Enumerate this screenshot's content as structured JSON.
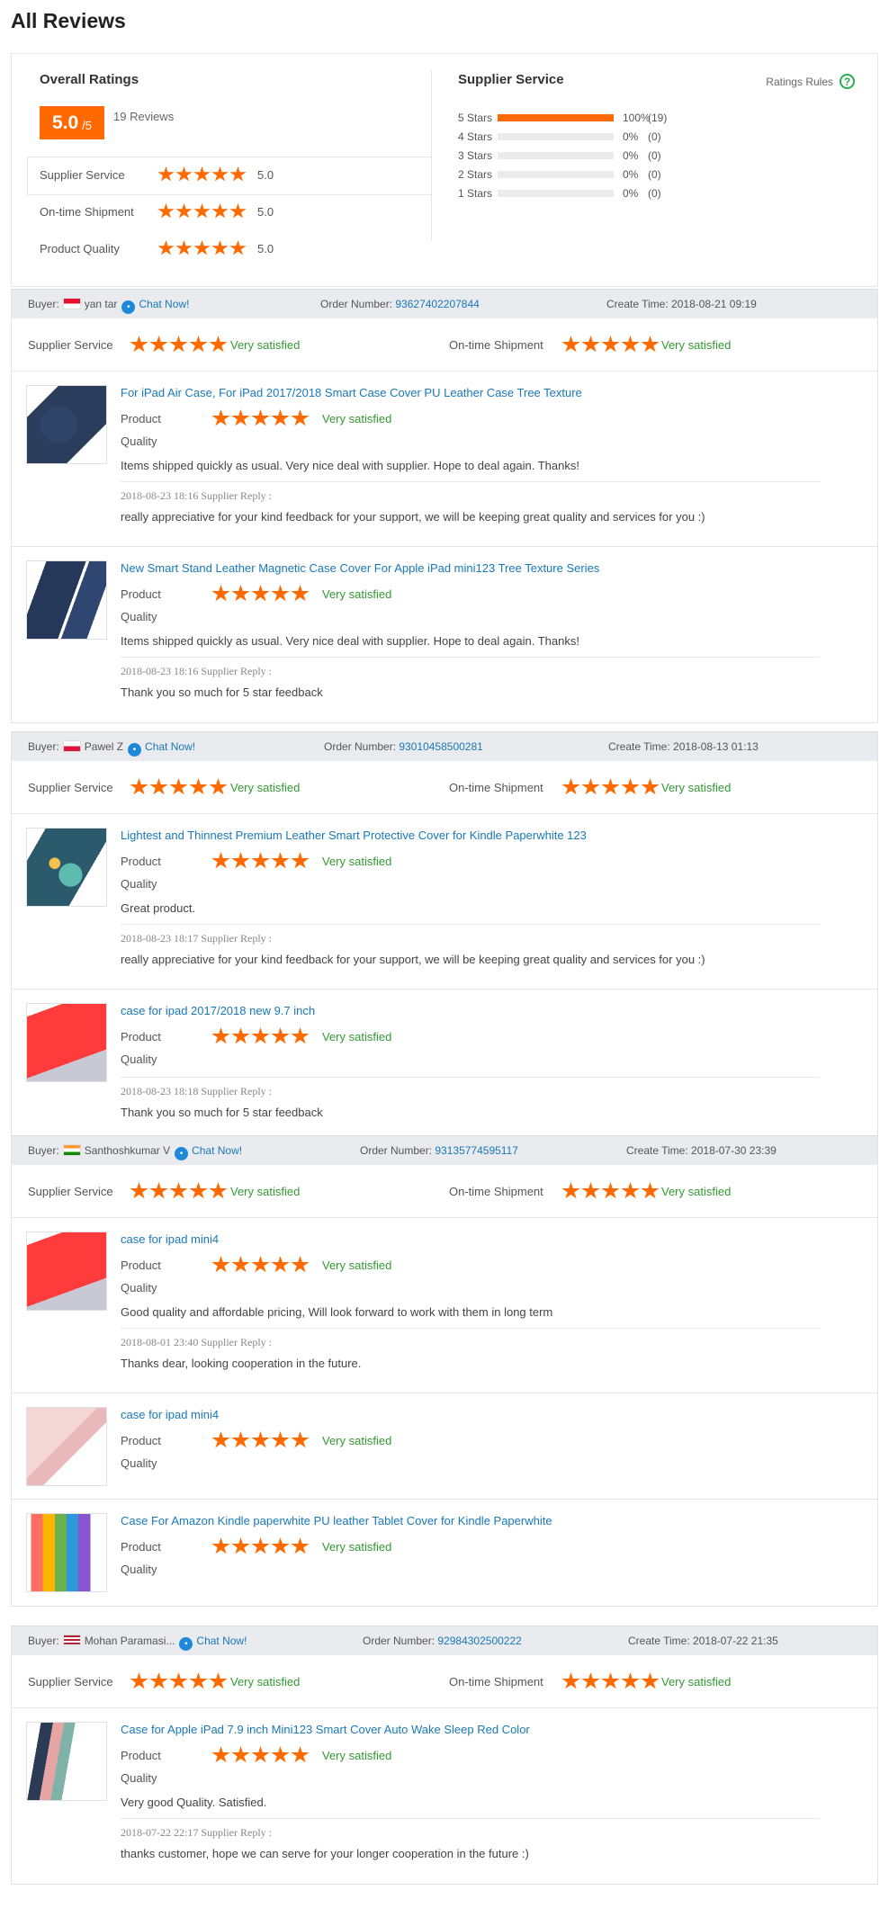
{
  "page_title": "All Reviews",
  "summary": {
    "overall_label": "Overall Ratings",
    "score": "5.0",
    "score_max": "/5",
    "reviews_count": "19 Reviews",
    "rows": [
      {
        "label": "Supplier Service",
        "value": "5.0",
        "stars": 5
      },
      {
        "label": "On-time Shipment",
        "value": "5.0",
        "stars": 5
      },
      {
        "label": "Product Quality",
        "value": "5.0",
        "stars": 5
      }
    ],
    "supplier_service_title": "Supplier Service",
    "ratings_rules": "Ratings Rules",
    "distribution": [
      {
        "label": "5 Stars",
        "percent": "100%",
        "count": "(19)",
        "fill": 1.0
      },
      {
        "label": "4 Stars",
        "percent": "0%",
        "count": "(0)",
        "fill": 0
      },
      {
        "label": "3 Stars",
        "percent": "0%",
        "count": "(0)",
        "fill": 0
      },
      {
        "label": "2 Stars",
        "percent": "0%",
        "count": "(0)",
        "fill": 0
      },
      {
        "label": "1 Stars",
        "percent": "0%",
        "count": "(0)",
        "fill": 0
      }
    ]
  },
  "labels": {
    "buyer": "Buyer:",
    "chat_now": "Chat Now!",
    "order_number": "Order Number:",
    "create_time": "Create Time:",
    "supplier_service": "Supplier Service",
    "on_time_shipment": "On-time Shipment",
    "very_satisfied": "Very satisfied",
    "product": "Product",
    "quality": "Quality",
    "supplier_reply": "Supplier Reply :"
  },
  "orders": [
    {
      "buyer": "yan tar",
      "flag": "sg",
      "order_number": "93627402207844",
      "create_time": "2018-08-21 09:19",
      "items": [
        {
          "title": "For iPad Air Case, For iPad 2017/2018 Smart Case Cover PU Leather Case Tree Texture",
          "thumb": "navy-case",
          "feedback": "Items shipped quickly as usual. Very nice deal with supplier. Hope to deal again. Thanks!",
          "reply_time": "2018-08-23 18:16",
          "reply": "really appreciative for your kind feedback for your support, we will be keeping great quality and services for you :)"
        },
        {
          "title": "New Smart Stand Leather Magnetic Case Cover For Apple iPad mini123 Tree Texture Series",
          "thumb": "navy-mini",
          "feedback": "Items shipped quickly as usual. Very nice deal with supplier. Hope to deal again. Thanks!",
          "reply_time": "2018-08-23 18:16",
          "reply": "Thank you so much for 5 star feedback"
        }
      ]
    },
    {
      "buyer": "Pawel Z",
      "flag": "pl",
      "order_number": "93010458500281",
      "create_time": "2018-08-13 01:13",
      "items": [
        {
          "title": "Lightest and Thinnest Premium Leather Smart Protective Cover for Kindle Paperwhite 123",
          "thumb": "art-kindle",
          "feedback": "Great product.",
          "reply_time": "2018-08-23 18:17",
          "reply": "really appreciative for your kind feedback for your support, we will be keeping great quality and services for you :)"
        },
        {
          "title": "case for ipad 2017/2018 new 9.7 inch",
          "thumb": "red-case",
          "feedback": "",
          "reply_time": "2018-08-23 18:18",
          "reply": "Thank you so much for 5 star feedback"
        }
      ]
    },
    {
      "buyer": "Santhoshkumar V",
      "flag": "in",
      "order_number": "93135774595117",
      "create_time": "2018-07-30 23:39",
      "items": [
        {
          "title": "case for ipad mini4",
          "thumb": "red-case",
          "feedback": "Good quality and affordable pricing, Will look forward to work with them in long term",
          "reply_time": "2018-08-01 23:40",
          "reply": "Thanks dear, looking cooperation in the future."
        },
        {
          "title": "case for ipad mini4",
          "thumb": "pink-case",
          "feedback": "",
          "reply_time": "",
          "reply": ""
        },
        {
          "title": "Case For Amazon Kindle paperwhite PU leather Tablet Cover for Kindle Paperwhite",
          "thumb": "rainbow-case",
          "feedback": "",
          "reply_time": "",
          "reply": ""
        }
      ]
    },
    {
      "buyer": "Mohan Paramasi...",
      "flag": "us",
      "order_number": "92984302500222",
      "create_time": "2018-07-22 21:35",
      "items": [
        {
          "title": "Case for Apple iPad 7.9 inch Mini123 Smart Cover Auto Wake Sleep Red Color",
          "thumb": "multi-case",
          "feedback": "Very good Quality. Satisfied.",
          "reply_time": "2018-07-22 22:17",
          "reply": "thanks customer, hope we can serve for your longer cooperation in the future :)"
        }
      ]
    }
  ],
  "colors": {
    "accent": "#ff6a00",
    "link": "#1978b8",
    "satisfied": "#339933",
    "header_bg": "#e9ebee"
  }
}
